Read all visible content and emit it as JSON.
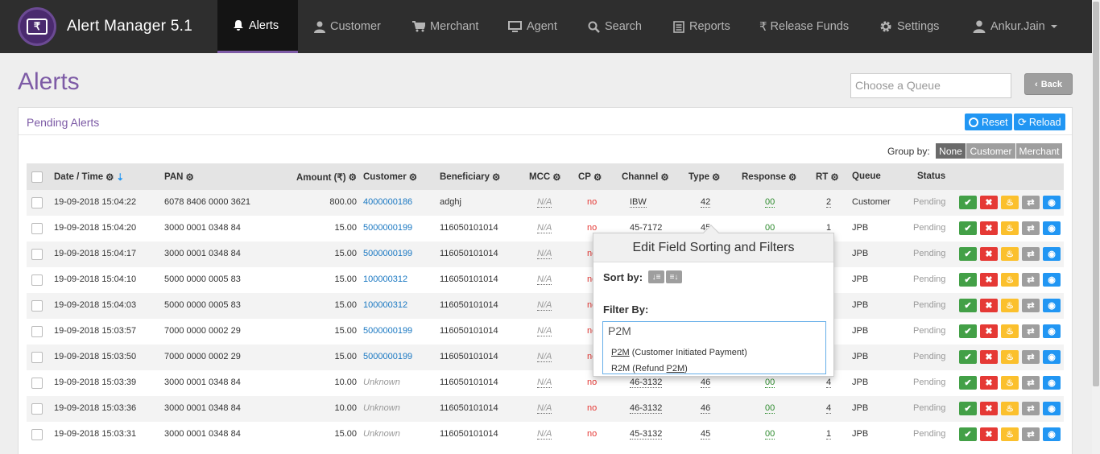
{
  "app": {
    "title": "Alert Manager 5.1",
    "logo_glyph": "₹",
    "accent": "#7d5ba6"
  },
  "nav": {
    "items": [
      {
        "label": "Alerts",
        "icon": "bell-icon"
      },
      {
        "label": "Customer",
        "icon": "user-icon"
      },
      {
        "label": "Merchant",
        "icon": "cart-icon"
      },
      {
        "label": "Agent",
        "icon": "monitor-icon"
      },
      {
        "label": "Search",
        "icon": "search-icon"
      },
      {
        "label": "Reports",
        "icon": "list-icon"
      },
      {
        "label": "Release Funds",
        "icon": "rupee-icon"
      },
      {
        "label": "Settings",
        "icon": "gear-icon"
      }
    ],
    "user": "Ankur.Jain"
  },
  "page": {
    "title": "Alerts",
    "queue_placeholder": "Choose a Queue",
    "back_label": "Back"
  },
  "panel": {
    "title": "Pending Alerts",
    "reset_label": "Reset",
    "reload_label": "Reload",
    "group_by_label": "Group by:",
    "group_options": [
      "None",
      "Customer",
      "Merchant"
    ],
    "group_selected": "None"
  },
  "table": {
    "headers": {
      "date": "Date / Time",
      "pan": "PAN",
      "amount": "Amount (₹)",
      "customer": "Customer",
      "beneficiary": "Beneficiary",
      "mcc": "MCC",
      "cp": "CP",
      "channel": "Channel",
      "type": "Type",
      "response": "Response",
      "rt": "RT",
      "queue": "Queue",
      "status": "Status"
    },
    "rows": [
      {
        "date": "19-09-2018 15:04:22",
        "pan": "6078 8406 0000 3621",
        "amount": "800.00",
        "customer": "4000000186",
        "beneficiary": "adghj",
        "mcc": "N/A",
        "cp": "no",
        "channel": "IBW",
        "type": "42",
        "response": "00",
        "rt": "2",
        "queue": "Customer",
        "status": "Pending"
      },
      {
        "date": "19-09-2018 15:04:20",
        "pan": "3000 0001 0348 84",
        "amount": "15.00",
        "customer": "5000000199",
        "beneficiary": "116050101014",
        "mcc": "N/A",
        "cp": "no",
        "channel": "45-7172",
        "type": "45",
        "response": "00",
        "rt": "1",
        "queue": "JPB",
        "status": "Pending"
      },
      {
        "date": "19-09-2018 15:04:17",
        "pan": "3000 0001 0348 84",
        "amount": "15.00",
        "customer": "5000000199",
        "beneficiary": "116050101014",
        "mcc": "N/A",
        "cp": "no",
        "channel": "",
        "type": "",
        "response": "",
        "rt": "",
        "queue": "JPB",
        "status": "Pending"
      },
      {
        "date": "19-09-2018 15:04:10",
        "pan": "5000 0000 0005 83",
        "amount": "15.00",
        "customer": "100000312",
        "beneficiary": "116050101014",
        "mcc": "N/A",
        "cp": "no",
        "channel": "",
        "type": "",
        "response": "",
        "rt": "",
        "queue": "JPB",
        "status": "Pending"
      },
      {
        "date": "19-09-2018 15:04:03",
        "pan": "5000 0000 0005 83",
        "amount": "15.00",
        "customer": "100000312",
        "beneficiary": "116050101014",
        "mcc": "N/A",
        "cp": "no",
        "channel": "",
        "type": "",
        "response": "",
        "rt": "",
        "queue": "JPB",
        "status": "Pending"
      },
      {
        "date": "19-09-2018 15:03:57",
        "pan": "7000 0000 0002 29",
        "amount": "15.00",
        "customer": "5000000199",
        "beneficiary": "116050101014",
        "mcc": "N/A",
        "cp": "no",
        "channel": "",
        "type": "",
        "response": "",
        "rt": "",
        "queue": "JPB",
        "status": "Pending"
      },
      {
        "date": "19-09-2018 15:03:50",
        "pan": "7000 0000 0002 29",
        "amount": "15.00",
        "customer": "5000000199",
        "beneficiary": "116050101014",
        "mcc": "N/A",
        "cp": "no",
        "channel": "",
        "type": "",
        "response": "",
        "rt": "",
        "queue": "JPB",
        "status": "Pending"
      },
      {
        "date": "19-09-2018 15:03:39",
        "pan": "3000 0001 0348 84",
        "amount": "10.00",
        "customer": "Unknown",
        "beneficiary": "116050101014",
        "mcc": "N/A",
        "cp": "no",
        "channel": "46-3132",
        "type": "46",
        "response": "00",
        "rt": "4",
        "queue": "JPB",
        "status": "Pending"
      },
      {
        "date": "19-09-2018 15:03:36",
        "pan": "3000 0001 0348 84",
        "amount": "10.00",
        "customer": "Unknown",
        "beneficiary": "116050101014",
        "mcc": "N/A",
        "cp": "no",
        "channel": "46-3132",
        "type": "46",
        "response": "00",
        "rt": "4",
        "queue": "JPB",
        "status": "Pending"
      },
      {
        "date": "19-09-2018 15:03:31",
        "pan": "3000 0001 0348 84",
        "amount": "15.00",
        "customer": "Unknown",
        "beneficiary": "116050101014",
        "mcc": "N/A",
        "cp": "no",
        "channel": "45-3132",
        "type": "45",
        "response": "00",
        "rt": "1",
        "queue": "JPB",
        "status": "Pending"
      }
    ],
    "row_actions": [
      "approve-icon",
      "reject-icon",
      "escalate-icon",
      "transfer-icon",
      "view-icon"
    ]
  },
  "popover": {
    "title": "Edit Field Sorting and Filters",
    "sort_label": "Sort by:",
    "filter_label": "Filter By:",
    "filter_value": "P2M",
    "suggestions": [
      {
        "code": "P2M",
        "desc": "(Customer Initiated Payment)"
      },
      {
        "code": "R2M",
        "desc": "(Refund P2M)"
      }
    ]
  }
}
